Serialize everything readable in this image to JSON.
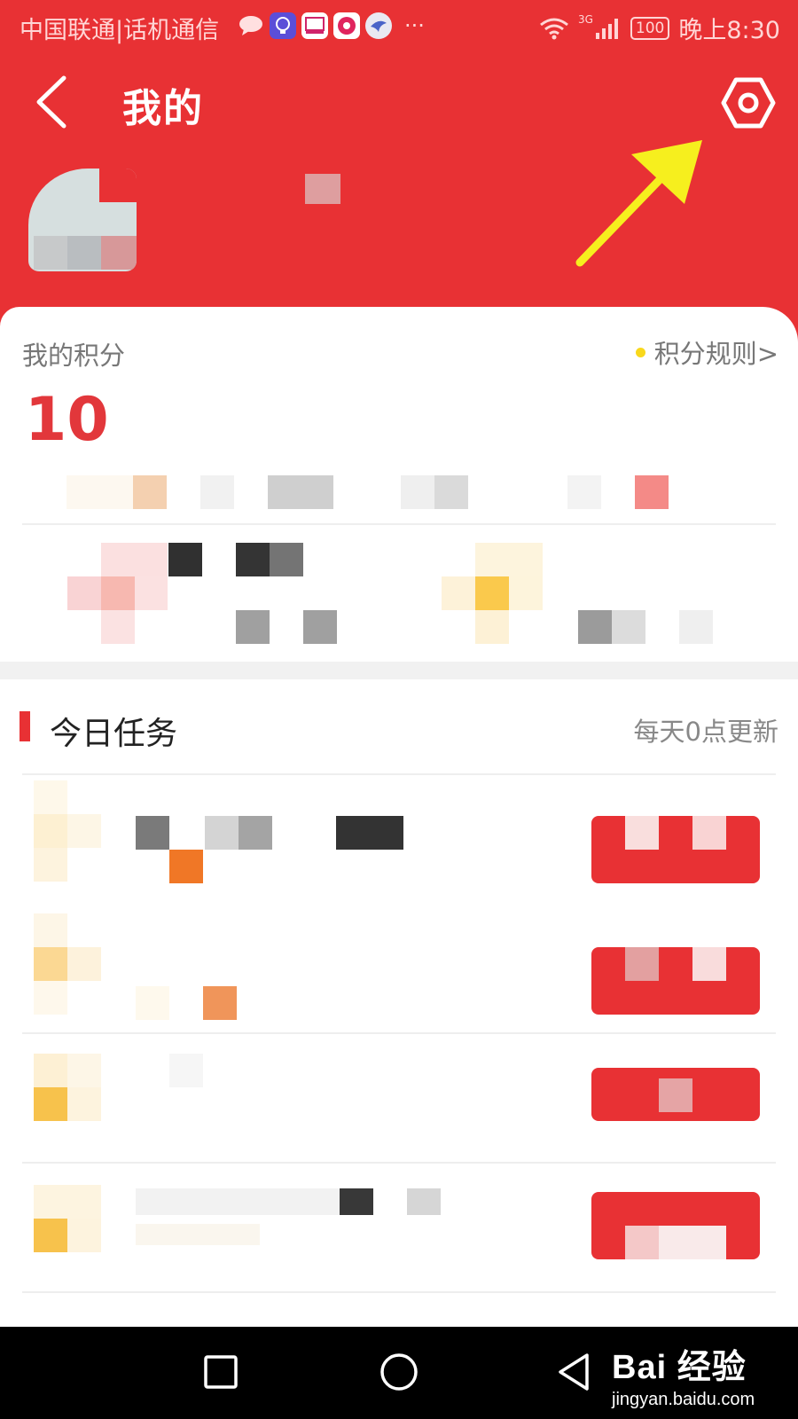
{
  "status_bar": {
    "carrier": "中国联通|话机通信",
    "network_type": "3G",
    "battery": "100",
    "time": "晚上8:30",
    "notification_icons": [
      "message-icon",
      "bulb-icon",
      "card-icon",
      "music-icon",
      "bird-icon"
    ]
  },
  "header": {
    "title": "我的",
    "back_icon": "chevron-left-icon",
    "settings_icon": "hexagon-gear-icon",
    "bg_color": "#e83134"
  },
  "points_card": {
    "label": "我的积分",
    "value": "10",
    "rules_link": "积分规则>",
    "value_color": "#e2373b",
    "dot_color": "#f9d81c"
  },
  "tasks": {
    "section_title": "今日任务",
    "update_note": "每天0点更新"
  },
  "nav": {
    "back_icon": "triangle-back-icon",
    "home_icon": "circle-home-icon",
    "recent_icon": "square-recent-icon"
  },
  "watermark": {
    "logo": "Bai 经验",
    "domain": "jingyan.baidu.com"
  }
}
